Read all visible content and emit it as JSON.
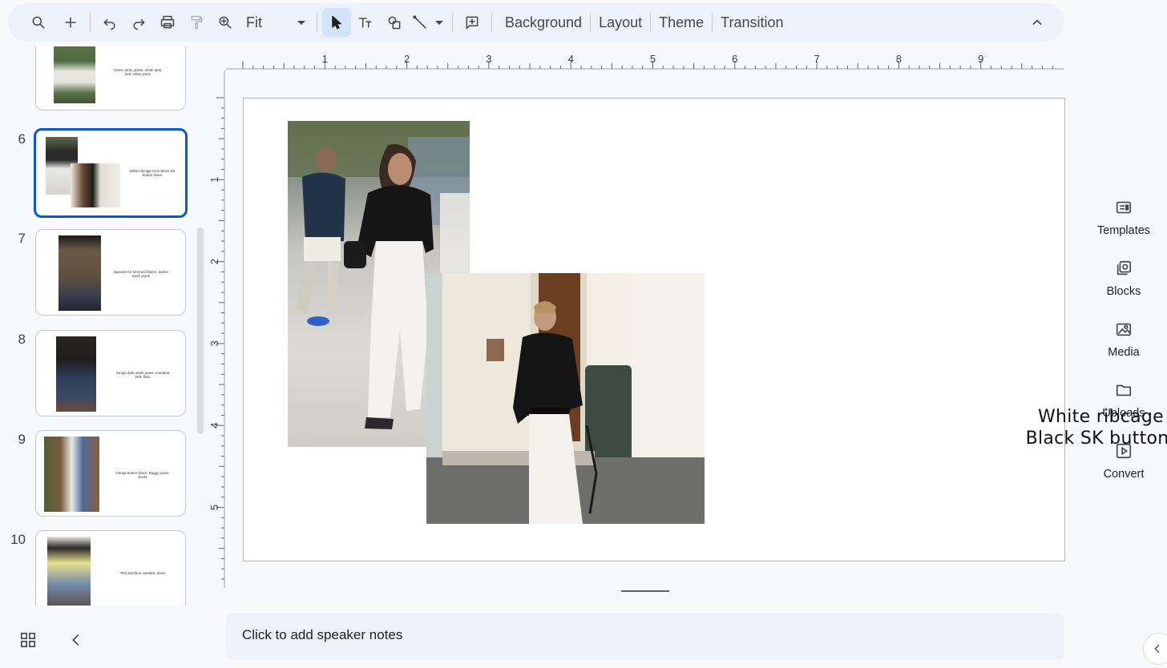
{
  "toolbar": {
    "zoom_value": "Fit",
    "menu_background": "Background",
    "menu_layout": "Layout",
    "menu_theme": "Theme",
    "menu_transition": "Transition"
  },
  "filmstrip": {
    "slides": [
      {
        "number": "",
        "caption": "Green army jacket, white tank, belt, white jeans"
      },
      {
        "number": "6",
        "caption": "White ribcage levis Black SK button down",
        "selected": true
      },
      {
        "number": "7",
        "caption": "Spanish fur trimmed blazer, darker wash jeans"
      },
      {
        "number": "8",
        "caption": "Ginaja dark wash jeans, montana belt, flats"
      },
      {
        "number": "9",
        "caption": "Ginaja button down, Baggy jeans, boots"
      },
      {
        "number": "10",
        "caption": "Teal and blue sweater, jeans"
      }
    ]
  },
  "ruler": {
    "horizontal": [
      "1",
      "2",
      "3",
      "4",
      "5",
      "6",
      "7",
      "8",
      "9"
    ],
    "vertical": [
      "1",
      "2",
      "3",
      "4",
      "5"
    ]
  },
  "slide": {
    "text_line1": "White ribcage levis",
    "text_line2": "Black SK button down"
  },
  "notes": {
    "placeholder": "Click to add speaker notes"
  },
  "side_panel": {
    "templates": "Templates",
    "blocks": "Blocks",
    "media": "Media",
    "uploads": "Uploads",
    "convert": "Convert"
  },
  "colors": {
    "accent": "#0b57d0",
    "toolbar_bg": "#edf2fa"
  }
}
